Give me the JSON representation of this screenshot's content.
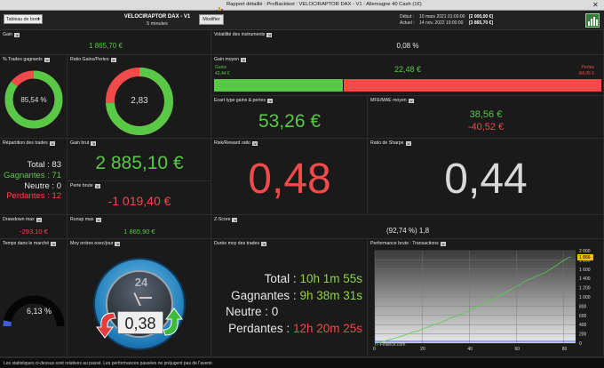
{
  "titlebar": {
    "title": "Rapport détaillé : ProBacktest : VELOCIRAPTOR DAX - V1 : Allemagne 40 Cash (1€)"
  },
  "toolbar": {
    "dashboard_select": "Tableau de bord",
    "strategy_name": "VELOCIRAPTOR DAX - V1",
    "timeframe": "5 minutes",
    "modify_button": "Modifier",
    "start_label": "Début :",
    "start_value": "10 mars 2021 01:00:00",
    "start_cash": "[2 000,00 €]",
    "end_label": "Actuel :",
    "end_value": "14 nov. 2022 19:00:00",
    "end_cash": "[3 865,70 €]"
  },
  "colors": {
    "green": "#59c847",
    "red": "#f04a4a",
    "panel": "#1a1a1a"
  },
  "panels": {
    "gain": {
      "label": "Gain",
      "value": "1 865,70 €"
    },
    "volatility": {
      "label": "Volatilité des instruments",
      "value": "0,08 %"
    },
    "pct_winning": {
      "label": "% Trades gagnants",
      "value": "85,54 %",
      "fraction": 0.8554
    },
    "ratio_gp": {
      "label": "Ratio Gains/Pertes",
      "value": "2,83",
      "fraction": 0.739
    },
    "avg_gain": {
      "label": "Gain moyen",
      "value": "22,48 €",
      "gain_label": "Gains",
      "gain_value": "42,44 €",
      "loss_label": "Pertes",
      "loss_value": "-84,06 €",
      "fraction": 0.335
    },
    "stddev": {
      "label": "Ecart type gains & pertes",
      "value": "53,26 €"
    },
    "mfe": {
      "label": "MFE/MAE moyen",
      "value1": "38,56 €",
      "value2": "-40,52 €"
    },
    "distribution": {
      "label": "Répartition des trades",
      "total": "Total : 83",
      "winners": "Gagnantes : 71",
      "neutral": "Neutre : 0",
      "losers": "Perdantes : 12"
    },
    "gross_gain": {
      "label": "Gain brut",
      "value": "2 885,10 €"
    },
    "gross_loss": {
      "label": "Perte brute",
      "value": "-1 019,40 €"
    },
    "risk_reward": {
      "label": "Risk/Reward ratio",
      "value": "0,48"
    },
    "sharpe": {
      "label": "Ratio de Sharpe",
      "value": "0,44"
    },
    "drawdown": {
      "label": "Drawdown max",
      "value": "-293,10 €"
    },
    "runup": {
      "label": "Runup max",
      "value": "1 865,90 €"
    },
    "zscore": {
      "label": "Z-Score",
      "value": "(92,74 %) 1,8"
    },
    "time_market": {
      "label": "Temps dans le marché",
      "value": "6,13 %",
      "fraction": 0.0613
    },
    "orders": {
      "label": "Moy ordres exec/jour",
      "value": "0,38",
      "clock_text": "24"
    },
    "duration": {
      "label": "Durée moy des trades",
      "total_label": "Total :",
      "total_value": "10h 1m 55s",
      "win_label": "Gagnantes :",
      "win_value": "9h 38m 31s",
      "neutral_label": "Neutre :",
      "neutral_value": "0",
      "loss_label": "Perdantes :",
      "loss_value": "12h 20m 25s"
    },
    "perf": {
      "label": "Performance brute : Transactions",
      "watermark": "IT-Finance.com"
    }
  },
  "chart_data": {
    "type": "line",
    "title": "Performance brute : Transactions",
    "x": [
      0,
      2,
      4,
      6,
      8,
      10,
      12,
      14,
      16,
      18,
      20,
      22,
      24,
      26,
      28,
      30,
      32,
      34,
      36,
      38,
      40,
      42,
      44,
      46,
      48,
      50,
      52,
      54,
      56,
      58,
      60,
      62,
      64,
      66,
      68,
      70,
      72,
      74,
      76,
      78,
      80,
      82,
      83
    ],
    "y": [
      0,
      20,
      40,
      70,
      100,
      130,
      160,
      200,
      240,
      260,
      300,
      340,
      380,
      410,
      450,
      490,
      540,
      580,
      620,
      650,
      700,
      760,
      800,
      850,
      900,
      950,
      1000,
      1060,
      1120,
      1170,
      1230,
      1290,
      1350,
      1390,
      1440,
      1480,
      1520,
      1590,
      1650,
      1720,
      1790,
      1850,
      1866
    ],
    "xticks": [
      "0",
      "20",
      "40",
      "60",
      "80"
    ],
    "yticks": [
      "0",
      "200",
      "400",
      "600",
      "800",
      "1 000",
      "1 200",
      "1 400",
      "1 600",
      "1 800",
      "2 000"
    ],
    "highlight_tick": "1 866",
    "xlim": [
      0,
      85
    ],
    "ylim": [
      0,
      2000
    ],
    "grid": true
  },
  "footer": {
    "disclaimer": "Les statistiques ci-dessus sont relatives au passé. Les performances passées ne préjugent pas de l'avenir."
  }
}
